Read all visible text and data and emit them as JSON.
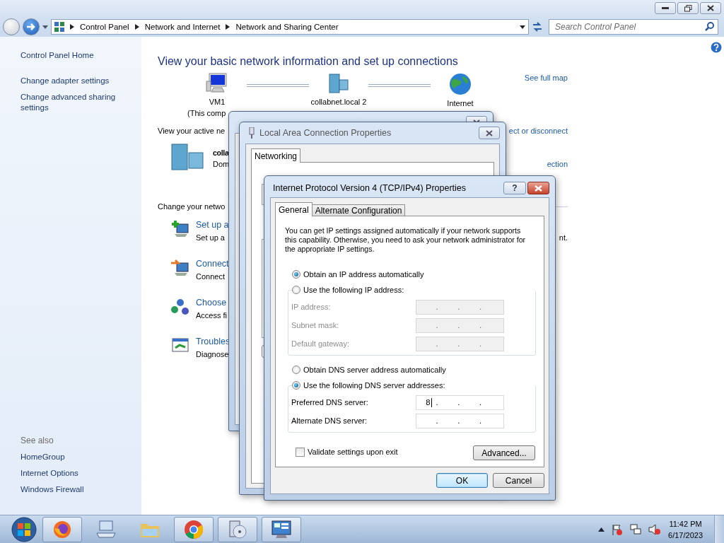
{
  "address_bar": {
    "breadcrumbs": [
      "Control Panel",
      "Network and Internet",
      "Network and Sharing Center"
    ]
  },
  "search": {
    "placeholder": "Search Control Panel"
  },
  "sidebar": {
    "items": [
      "Control Panel Home",
      "Change adapter settings",
      "Change advanced sharing settings"
    ],
    "see_also": {
      "label": "See also",
      "items": [
        "HomeGroup",
        "Internet Options",
        "Windows Firewall"
      ]
    }
  },
  "main": {
    "heading": "View your basic network information and set up connections",
    "map_link": "See full map",
    "map_nodes": [
      {
        "kind": "computer",
        "name": "VM1",
        "sub": "(This comp"
      },
      {
        "kind": "domain",
        "name": "collabnet.local  2"
      },
      {
        "kind": "globe",
        "name": "Internet"
      }
    ],
    "active_label": "View your active ne",
    "active_link": "ect or disconnect",
    "network": {
      "name": "colla",
      "type": "Dom",
      "link": "ection"
    },
    "change_label": "Change your netwo",
    "tasks": [
      {
        "kind": "setup",
        "title": "Set up a",
        "description": "Set up a",
        "tail": "nt."
      },
      {
        "kind": "connect",
        "title": "Connect",
        "description": "Connect"
      },
      {
        "kind": "homegroup",
        "title": "Choose",
        "description": "Access fi"
      },
      {
        "kind": "troubleshoot",
        "title": "Troubles",
        "description": "Diagnose"
      }
    ]
  },
  "properties_dialog": {
    "title": "Local Area Connection Properties",
    "tabs": [
      {
        "label": "Networking",
        "selected": true
      }
    ]
  },
  "ipv4_dialog": {
    "title": "Internet Protocol Version 4 (TCP/IPv4) Properties",
    "help": "?",
    "tabs": [
      {
        "label": "General",
        "selected": true
      },
      {
        "label": "Alternate Configuration",
        "selected": false
      }
    ],
    "intro": "You can get IP settings assigned automatically if your network supports this capability. Otherwise, you need to ask your network administrator for the appropriate IP settings.",
    "separator": ".",
    "ip_options": [
      {
        "label": "Obtain an IP address automatically",
        "selected": true
      },
      {
        "label": "Use the following IP address:",
        "selected": false
      }
    ],
    "ip_fields": [
      {
        "label": "IP address:",
        "disabled": true
      },
      {
        "label": "Subnet mask:",
        "disabled": true
      },
      {
        "label": "Default gateway:",
        "disabled": true
      }
    ],
    "dns_options": [
      {
        "label": "Obtain DNS server address automatically",
        "selected": false
      },
      {
        "label": "Use the following DNS server addresses:",
        "selected": true
      }
    ],
    "dns_fields": [
      {
        "label": "Preferred DNS server:",
        "value": "8",
        "disabled": false,
        "focused": true
      },
      {
        "label": "Alternate DNS server:",
        "disabled": false,
        "focused": false
      }
    ],
    "validate": {
      "label": "Validate settings upon exit",
      "checked": false
    },
    "advanced": "Advanced...",
    "buttons": [
      {
        "label": "OK",
        "default": true
      },
      {
        "label": "Cancel",
        "default": false
      }
    ]
  },
  "taskbar": {
    "apps": [
      {
        "kind": "firefox",
        "running": true
      },
      {
        "kind": "computer",
        "running": false
      },
      {
        "kind": "folder",
        "running": false
      },
      {
        "kind": "chrome",
        "running": true
      },
      {
        "kind": "media",
        "running": true
      },
      {
        "kind": "controlpanel",
        "running": true
      }
    ],
    "clock": {
      "time": "11:42 PM",
      "date": "6/17/2023"
    }
  }
}
